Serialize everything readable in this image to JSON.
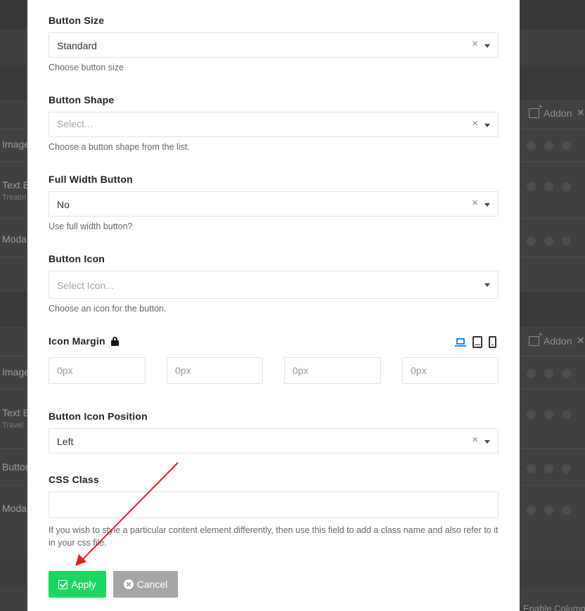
{
  "background": {
    "rows": [
      {
        "label": "Image"
      },
      {
        "label": "Text B",
        "sub": "Treatm"
      },
      {
        "label": "Moda"
      },
      {
        "label": "Image"
      },
      {
        "label": "Text B",
        "sub": "Travel"
      },
      {
        "label": "Button"
      },
      {
        "label": "Moda"
      }
    ],
    "addon_label": "Addon",
    "bottom_text": "Enable Column"
  },
  "form": {
    "button_size": {
      "label": "Button Size",
      "value": "Standard",
      "help": "Choose button size"
    },
    "button_shape": {
      "label": "Button Shape",
      "placeholder": "Select...",
      "help": "Choose a button shape from the list."
    },
    "full_width": {
      "label": "Full Width Button",
      "value": "No",
      "help": "Use full width button?"
    },
    "button_icon": {
      "label": "Button Icon",
      "placeholder": "Select Icon...",
      "help": "Choose an icon for the button."
    },
    "icon_margin": {
      "label": "Icon Margin",
      "placeholders": [
        "0px",
        "0px",
        "0px",
        "0px"
      ]
    },
    "icon_position": {
      "label": "Button Icon Position",
      "value": "Left"
    },
    "css_class": {
      "label": "CSS Class",
      "value": "",
      "help": "If you wish to style a particular content element differently, then use this field to add a class name and also refer to it in your css file."
    },
    "clear_glyph": "×"
  },
  "actions": {
    "apply_label": "Apply",
    "cancel_label": "Cancel"
  },
  "colors": {
    "apply": "#1ed760",
    "cancel": "#a6a6a6",
    "device_active": "#1e88e5",
    "annotation_arrow": "#e8201f"
  }
}
